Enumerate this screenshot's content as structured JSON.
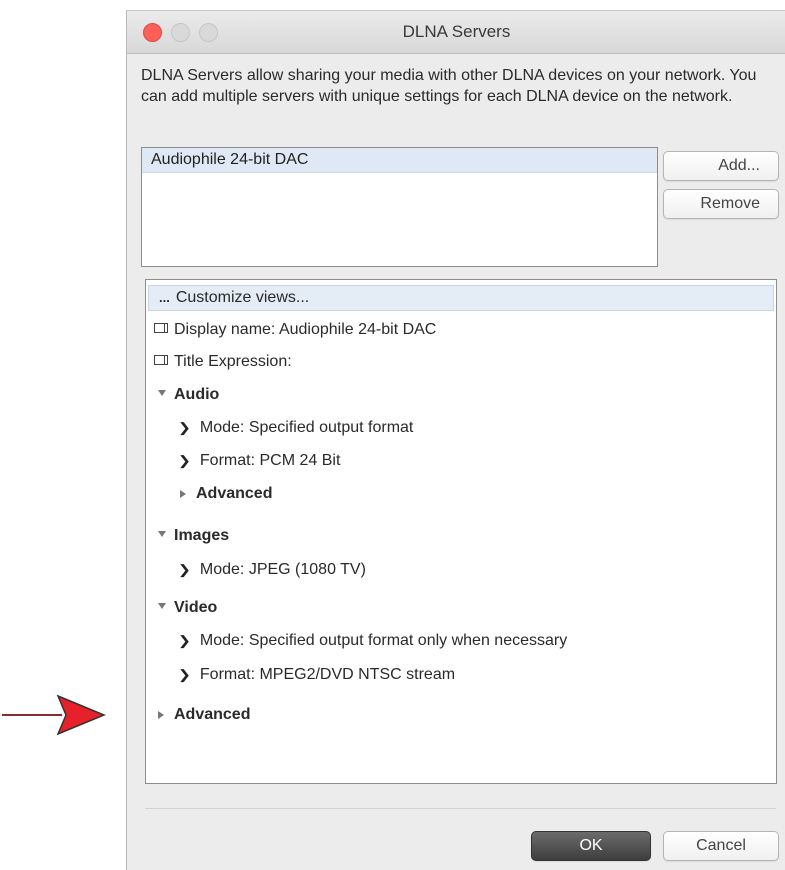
{
  "window": {
    "title": "DLNA Servers"
  },
  "description": "DLNA Servers allow sharing your media with other DLNA devices on your network.  You can add multiple servers with unique settings for each DLNA device on the network.",
  "servers": [
    "Audiophile 24-bit DAC"
  ],
  "buttons": {
    "add": "Add...",
    "remove": "Remove",
    "ok": "OK",
    "cancel": "Cancel"
  },
  "settings": {
    "customize": "Customize views...",
    "customize_icon": "...",
    "display_name": "Display name: Audiophile 24-bit DAC",
    "title_expression": "Title Expression:",
    "audio": {
      "label": "Audio",
      "mode": "Mode: Specified output format",
      "format": "Format: PCM 24 Bit",
      "advanced": "Advanced"
    },
    "images": {
      "label": "Images",
      "mode": "Mode: JPEG (1080 TV)"
    },
    "video": {
      "label": "Video",
      "mode": "Mode: Specified output format only when necessary",
      "format": "Format: MPEG2/DVD NTSC stream"
    },
    "advanced": "Advanced"
  },
  "colors": {
    "accent_close": "#fc5f57",
    "arrow": "#e8202a",
    "ok_button": "#4a4a4a"
  }
}
